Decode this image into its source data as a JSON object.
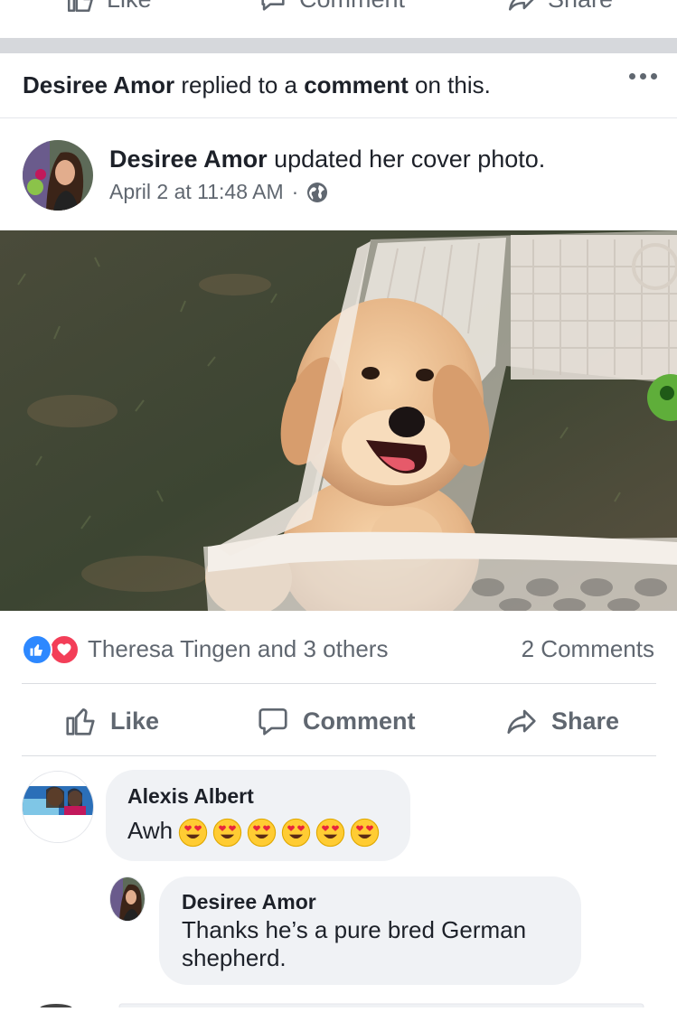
{
  "prev_post_actions": {
    "like": "Like",
    "comment": "Comment",
    "share": "Share"
  },
  "context": {
    "actor": "Desiree Amor",
    "middle": " replied to a ",
    "object": "comment",
    "suffix": " on this."
  },
  "post": {
    "author": "Desiree Amor",
    "action": " updated her cover photo.",
    "timestamp": "April 2 at 11:48 AM",
    "separator": "·",
    "privacy_icon": "globe-icon",
    "photo_icon": "puppy-photo"
  },
  "reactions": {
    "icons": [
      "like-reaction-icon",
      "love-reaction-icon"
    ],
    "names": "Theresa Tingen and 3 others",
    "comments_count": "2 Comments"
  },
  "actions": {
    "like": "Like",
    "comment": "Comment",
    "share": "Share"
  },
  "comments": [
    {
      "author": "Alexis Albert",
      "text": "Awh",
      "emoji_count": 6,
      "emoji": "heart-eyes-emoji"
    },
    {
      "author": "Desiree Amor",
      "line1": "Thanks he’s a pure bred German",
      "line2": "shepherd."
    }
  ],
  "colors": {
    "brand_blue": "#4267b2",
    "like_blue": "#2d88ff",
    "love_red": "#f33e58",
    "bubble_gray": "#f0f2f5",
    "secondary_text": "#606770"
  }
}
